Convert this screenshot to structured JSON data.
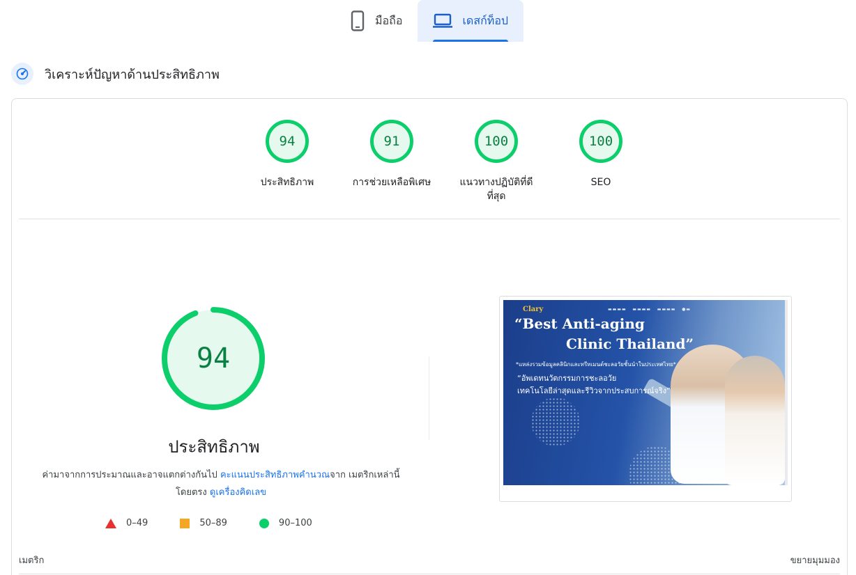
{
  "tabs": [
    {
      "label": "มือถือ",
      "icon": "smartphone-icon",
      "active": false
    },
    {
      "label": "เดสก์ท็อป",
      "icon": "laptop-icon",
      "active": true
    }
  ],
  "section": {
    "title": "วิเคราะห์ปัญหาด้านประสิทธิภาพ",
    "icon": "speed-gauge-icon"
  },
  "scores": [
    {
      "value": "94",
      "label": "ประสิทธิภาพ"
    },
    {
      "value": "91",
      "label": "การช่วยเหลือพิเศษ"
    },
    {
      "value": "100",
      "label": "แนวทางปฏิบัติที่ดีที่สุด"
    },
    {
      "value": "100",
      "label": "SEO"
    }
  ],
  "performance": {
    "score": "94",
    "score_fraction": 0.94,
    "title": "ประสิทธิภาพ",
    "desc_prefix": "ค่ามาจากการประมาณและอาจแตกต่างกันไป ",
    "desc_link1": "คะแนนประสิทธิภาพคำนวณ",
    "desc_middle": "จาก เมตริกเหล่านี้โดยตรง ",
    "desc_link2": "ดูเครื่องคิดเลข"
  },
  "legend": [
    {
      "range": "0–49",
      "shape": "triangle",
      "color": "#e8312f"
    },
    {
      "range": "50–89",
      "shape": "square",
      "color": "#f5a623"
    },
    {
      "range": "90–100",
      "shape": "circle",
      "color": "#0cce6b"
    }
  ],
  "screenshot": {
    "logo": "Clary",
    "headline_line1": "“Best Anti-aging",
    "headline_line2": "Clinic Thailand”",
    "subline": "*แหล่งรวมข้อมูลคลินิกและทรีทเมนต์ชะลอวัยชั้นนำในประเทศไทย*",
    "tagline_line1": "“อัพเดทนวัตกรรมการชะลอวัย",
    "tagline_line2": "เทคโนโลยีล่าสุดและรีวิวจากประสบการณ์จริง”"
  },
  "footer": {
    "metrics_label": "เมตริก",
    "expand_label": "ขยายมุมมอง"
  },
  "colors": {
    "good": "#0cce6b",
    "good_text": "#0b8043",
    "accent": "#1a73e8"
  }
}
